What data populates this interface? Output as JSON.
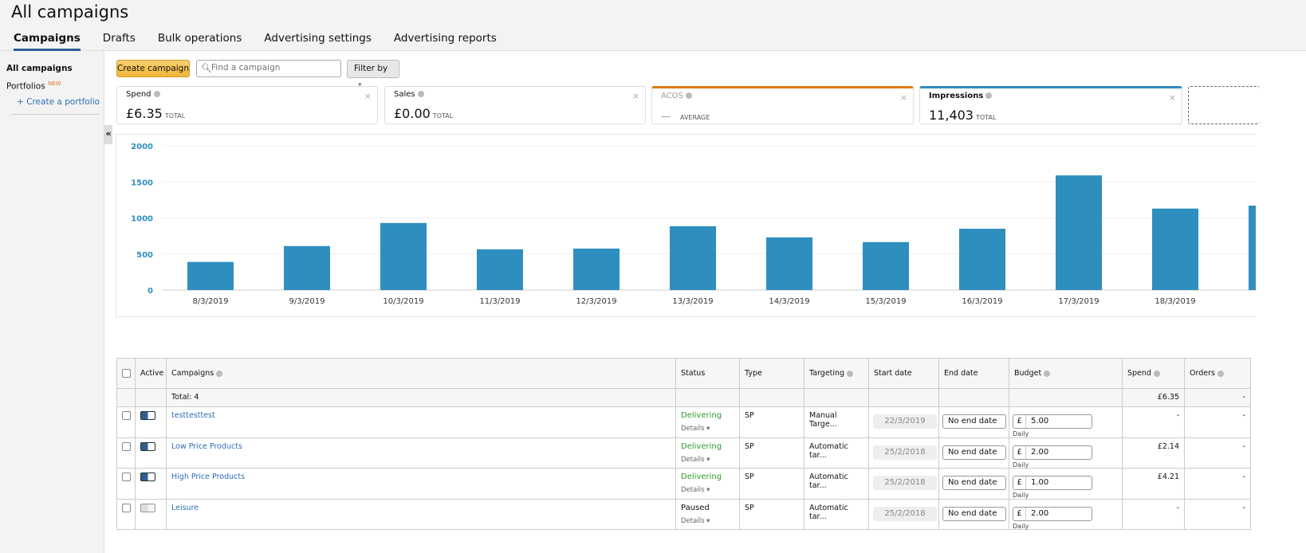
{
  "header": {
    "title": "All campaigns",
    "tabs": [
      {
        "label": "Campaigns",
        "active": true
      },
      {
        "label": "Drafts"
      },
      {
        "label": "Bulk operations"
      },
      {
        "label": "Advertising settings"
      },
      {
        "label": "Advertising reports"
      }
    ]
  },
  "sidebar": {
    "all_campaigns": "All campaigns",
    "portfolios": "Portfolios",
    "new_badge": "NEW",
    "create_portfolio": "+ Create a portfolio",
    "collapse_icon": "«"
  },
  "toolbar": {
    "create_label": "Create campaign",
    "search_placeholder": "Find a campaign",
    "filter_label": "Filter by",
    "filter_icon": "⇕"
  },
  "metrics": [
    {
      "label": "Spend",
      "value": "£6.35",
      "suffix": "TOTAL"
    },
    {
      "label": "Sales",
      "value": "£0.00",
      "suffix": "TOTAL"
    },
    {
      "label": "ACOS",
      "value": "—",
      "suffix": "AVERAGE",
      "accent": "#e47911"
    },
    {
      "label": "Impressions",
      "value": "11,403",
      "suffix": "TOTAL",
      "accent": "#2e8ebe"
    }
  ],
  "chart_data": {
    "type": "bar",
    "categories": [
      "8/3/2019",
      "9/3/2019",
      "10/3/2019",
      "11/3/2019",
      "12/3/2019",
      "13/3/2019",
      "14/3/2019",
      "15/3/2019",
      "16/3/2019",
      "17/3/2019",
      "18/3/2019",
      ""
    ],
    "values": [
      390,
      610,
      930,
      565,
      575,
      885,
      730,
      665,
      850,
      1590,
      1130,
      1170
    ],
    "ylim": [
      0,
      2000
    ],
    "yticks": [
      "0",
      "500",
      "1000",
      "1500",
      "2000"
    ],
    "color": "#2e8ebe",
    "grid": true
  },
  "table": {
    "headers": {
      "active": "Active",
      "campaigns": "Campaigns",
      "status": "Status",
      "type": "Type",
      "targeting": "Targeting",
      "start": "Start date",
      "end": "End date",
      "budget": "Budget",
      "spend": "Spend",
      "orders": "Orders"
    },
    "total": {
      "label": "Total: 4",
      "spend": "£6.35",
      "orders": "-"
    },
    "rows": [
      {
        "name": "testtesttest",
        "active": true,
        "status": "Delivering",
        "details": "Details ▾",
        "type": "SP",
        "targeting": "Manual Targe...",
        "start": "22/3/2019",
        "end": "No end date",
        "currency": "£",
        "budget": "5.00",
        "period": "Daily",
        "spend": "-",
        "orders": "-"
      },
      {
        "name": "Low Price Products",
        "active": true,
        "status": "Delivering",
        "details": "Details ▾",
        "type": "SP",
        "targeting": "Automatic tar...",
        "start": "25/2/2018",
        "end": "No end date",
        "currency": "£",
        "budget": "2.00",
        "period": "Daily",
        "spend": "£2.14",
        "orders": "-"
      },
      {
        "name": "High Price Products",
        "active": true,
        "status": "Delivering",
        "details": "Details ▾",
        "type": "SP",
        "targeting": "Automatic tar...",
        "start": "25/2/2018",
        "end": "No end date",
        "currency": "£",
        "budget": "1.00",
        "period": "Daily",
        "spend": "£4.21",
        "orders": "-"
      },
      {
        "name": "Leisure",
        "active": false,
        "status": "Paused",
        "details": "Details ▾",
        "type": "SP",
        "targeting": "Automatic tar...",
        "start": "25/2/2018",
        "end": "No end date",
        "currency": "£",
        "budget": "2.00",
        "period": "Daily",
        "spend": "-",
        "orders": "-"
      }
    ]
  }
}
